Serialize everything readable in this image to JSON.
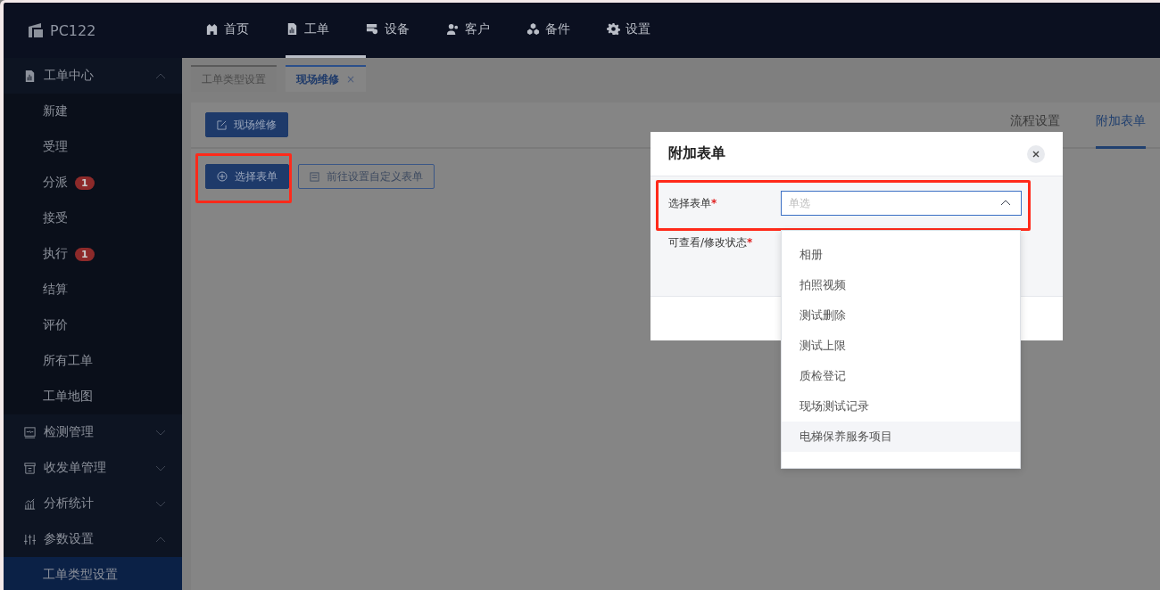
{
  "app": {
    "logo_text": "PC122"
  },
  "top_nav": [
    {
      "label": "首页",
      "selected": false
    },
    {
      "label": "工单",
      "selected": true
    },
    {
      "label": "设备",
      "selected": false
    },
    {
      "label": "客户",
      "selected": false
    },
    {
      "label": "备件",
      "selected": false
    },
    {
      "label": "设置",
      "selected": false
    }
  ],
  "sidebar": [
    {
      "label": "工单中心",
      "expanded": true,
      "children": [
        {
          "label": "新建",
          "selected": false
        },
        {
          "label": "受理",
          "selected": false
        },
        {
          "label": "分派",
          "badge": "1",
          "selected": false
        },
        {
          "label": "接受",
          "selected": false
        },
        {
          "label": "执行",
          "badge": "1",
          "selected": false
        },
        {
          "label": "结算",
          "selected": false
        },
        {
          "label": "评价",
          "selected": false
        },
        {
          "label": "所有工单",
          "selected": false
        },
        {
          "label": "工单地图",
          "selected": false
        }
      ]
    },
    {
      "label": "检测管理",
      "expanded": false
    },
    {
      "label": "收发单管理",
      "expanded": false
    },
    {
      "label": "分析统计",
      "expanded": false
    },
    {
      "label": "参数设置",
      "expanded": true,
      "children": [
        {
          "label": "工单类型设置",
          "selected": true
        }
      ]
    }
  ],
  "page_tabs": [
    {
      "label": "工单类型设置",
      "selected": false
    },
    {
      "label": "现场维修",
      "selected": true,
      "close": "×"
    }
  ],
  "card": {
    "title_button": "现场维修",
    "side_tabs": [
      {
        "label": "流程设置",
        "selected": false
      },
      {
        "label": "附加表单",
        "selected": true
      }
    ],
    "buttons": [
      {
        "label": "选择表单",
        "kind": "primary"
      },
      {
        "label": "前往设置自定义表单",
        "kind": "outline"
      }
    ]
  },
  "dialog": {
    "title": "附加表单",
    "fields": [
      {
        "label": "选择表单",
        "required_mark": "*",
        "placeholder": "单选",
        "open": true
      },
      {
        "label": "可查看/修改状态",
        "required_mark": "*"
      }
    ],
    "options": [
      {
        "label": "相册",
        "highlighted": false
      },
      {
        "label": "拍照视频",
        "highlighted": false
      },
      {
        "label": "测试删除",
        "highlighted": false
      },
      {
        "label": "测试上限",
        "highlighted": false
      },
      {
        "label": "质检登记",
        "highlighted": false
      },
      {
        "label": "现场测试记录",
        "highlighted": false
      },
      {
        "label": "电梯保养服务项目",
        "highlighted": true
      }
    ]
  }
}
